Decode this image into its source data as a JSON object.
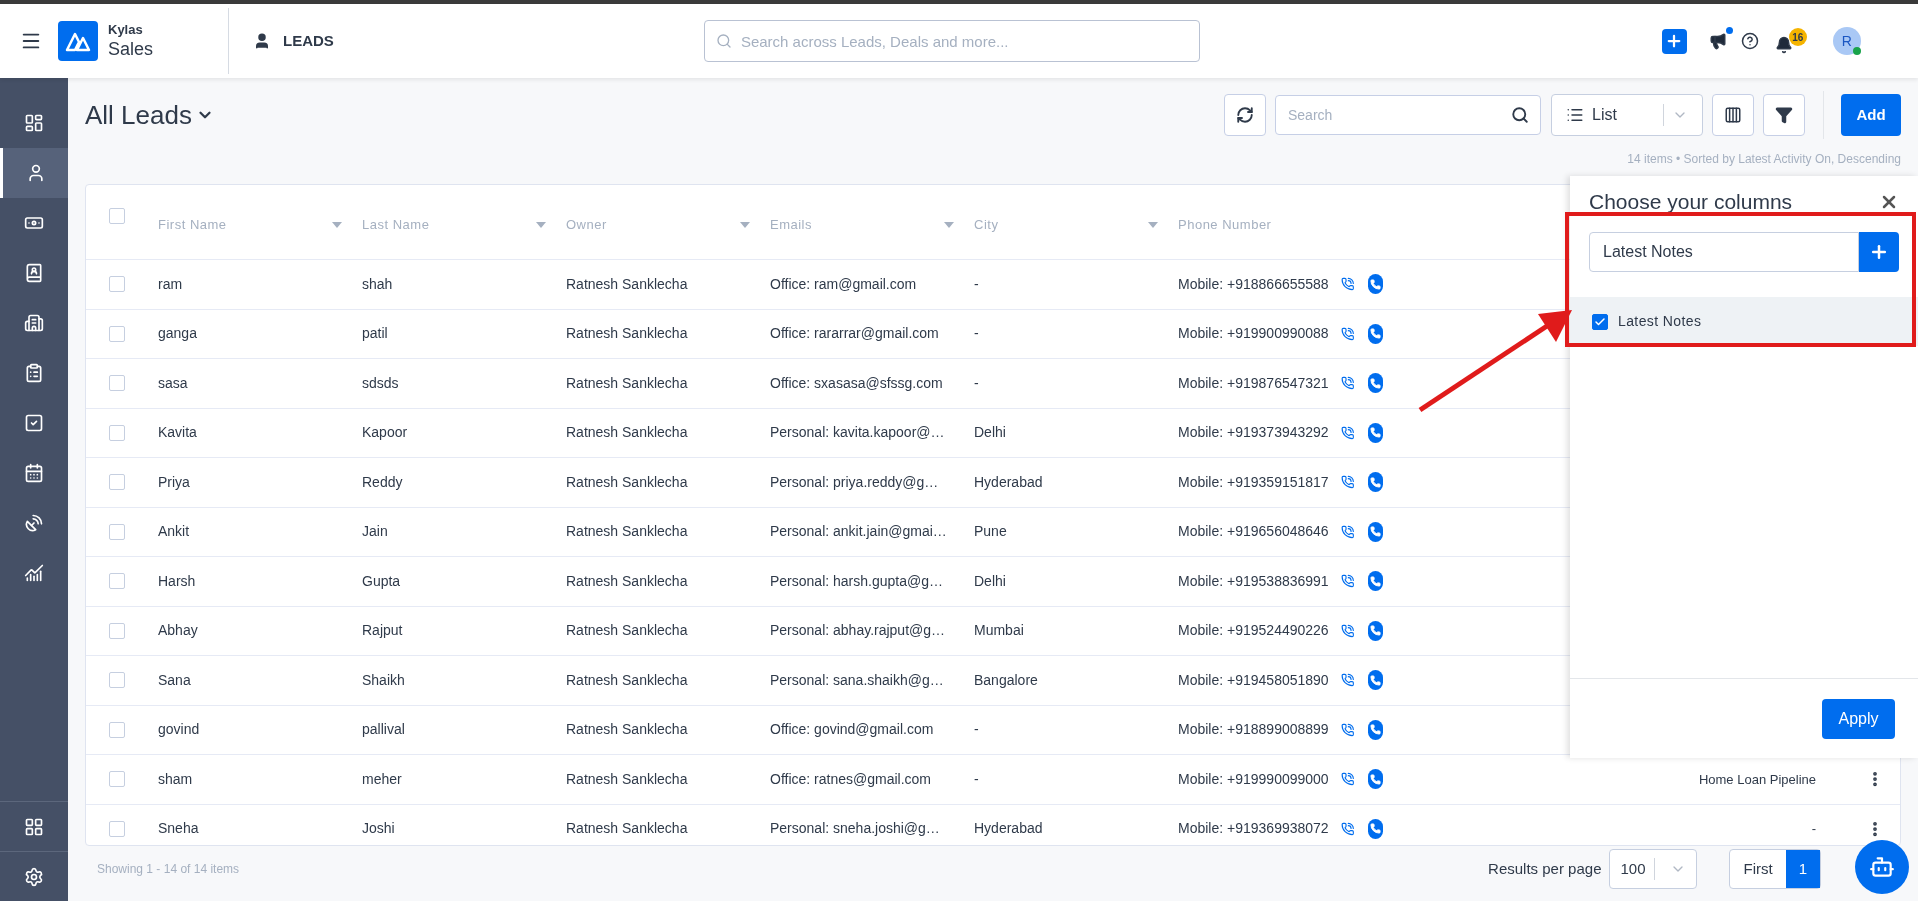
{
  "topbar": {
    "brand_top": "Kylas",
    "brand_bottom": "Sales",
    "module": "LEADS",
    "search_placeholder": "Search across Leads, Deals and more...",
    "notification_count": "16",
    "avatar_letter": "R",
    "announcement_dot": true,
    "online": true
  },
  "sidebar": {
    "items": [
      {
        "kind": "dashboard",
        "selected": false
      },
      {
        "kind": "user",
        "selected": true
      },
      {
        "kind": "money",
        "selected": false
      },
      {
        "kind": "contact",
        "selected": false
      },
      {
        "kind": "building",
        "selected": false
      },
      {
        "kind": "clipboard",
        "selected": false
      },
      {
        "kind": "check",
        "selected": false
      },
      {
        "kind": "calendar",
        "selected": false
      },
      {
        "kind": "dish",
        "selected": false
      },
      {
        "kind": "chart",
        "selected": false
      }
    ],
    "bottom": [
      {
        "kind": "apps"
      },
      {
        "kind": "settings"
      }
    ]
  },
  "page": {
    "title": "All Leads",
    "search_placeholder": "Search",
    "view": "List",
    "add": "Add",
    "summary": "14 items • Sorted by Latest Activity On, Descending"
  },
  "table": {
    "all_checked": false,
    "columns": [
      "First Name",
      "Last Name",
      "Owner",
      "Emails",
      "City",
      "Phone Number"
    ],
    "rows": [
      {
        "checked": false,
        "cells": [
          "ram",
          "shah",
          "Ratnesh Sanklecha",
          "Office: ram@gmail.com",
          "-",
          "Mobile: +918866655588"
        ]
      },
      {
        "checked": false,
        "cells": [
          "ganga",
          "patil",
          "Ratnesh Sanklecha",
          "Office: rararrar@gmail.com",
          "-",
          "Mobile: +919900990088"
        ]
      },
      {
        "checked": false,
        "cells": [
          "sasa",
          "sdsds",
          "Ratnesh Sanklecha",
          "Office: sxasasa@sfssg.com",
          "-",
          "Mobile: +919876547321"
        ]
      },
      {
        "checked": false,
        "cells": [
          "Kavita",
          "Kapoor",
          "Ratnesh Sanklecha",
          "Personal: kavita.kapoor@…",
          "Delhi",
          "Mobile: +919373943292"
        ]
      },
      {
        "checked": false,
        "cells": [
          "Priya",
          "Reddy",
          "Ratnesh Sanklecha",
          "Personal: priya.reddy@g…",
          "Hyderabad",
          "Mobile: +919359151817"
        ]
      },
      {
        "checked": false,
        "cells": [
          "Ankit",
          "Jain",
          "Ratnesh Sanklecha",
          "Personal: ankit.jain@gmai…",
          "Pune",
          "Mobile: +919656048646"
        ]
      },
      {
        "checked": false,
        "cells": [
          "Harsh",
          "Gupta",
          "Ratnesh Sanklecha",
          "Personal: harsh.gupta@g…",
          "Delhi",
          "Mobile: +919538836991"
        ]
      },
      {
        "checked": false,
        "cells": [
          "Abhay",
          "Rajput",
          "Ratnesh Sanklecha",
          "Personal: abhay.rajput@g…",
          "Mumbai",
          "Mobile: +919524490226"
        ]
      },
      {
        "checked": false,
        "cells": [
          "Sana",
          "Shaikh",
          "Ratnesh Sanklecha",
          "Personal: sana.shaikh@g…",
          "Bangalore",
          "Mobile: +919458051890"
        ]
      },
      {
        "checked": false,
        "cells": [
          "govind",
          "pallival",
          "Ratnesh Sanklecha",
          "Office: govind@gmail.com",
          "-",
          "Mobile: +918899008899"
        ]
      },
      {
        "checked": false,
        "cells": [
          "sham",
          "meher",
          "Ratnesh Sanklecha",
          "Office: ratnes@gmail.com",
          "-",
          "Mobile: +919990099000"
        ],
        "column_7": "Home Loan Pipeline"
      },
      {
        "checked": false,
        "cells": [
          "Sneha",
          "Joshi",
          "Ratnesh Sanklecha",
          "Personal: sneha.joshi@g…",
          "Hyderabad",
          "Mobile: +919369938072"
        ],
        "column_7": "-"
      }
    ]
  },
  "footer": {
    "showing": "Showing 1 - 14 of 14 items",
    "results_label": "Results per page",
    "per_page": "100",
    "pages": [
      {
        "label": "First",
        "selected": false
      },
      {
        "label": "1",
        "selected": true
      }
    ]
  },
  "panel": {
    "title": "Choose your columns",
    "search_value": "Latest Notes",
    "options": [
      {
        "label": "Latest Notes",
        "checked": true
      }
    ],
    "apply": "Apply"
  }
}
